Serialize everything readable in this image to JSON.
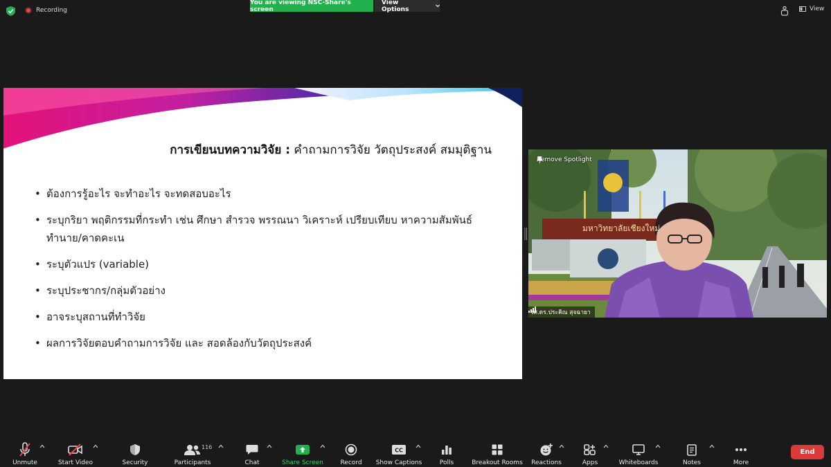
{
  "topbar": {
    "recording_label": "Recording",
    "viewing_banner": "You are viewing NSC-Share's screen",
    "view_options_label": "View Options",
    "view_label": "View"
  },
  "slide": {
    "title_bold": "การเขียนบทความวิจัย :",
    "title_rest": " คำถามการวิจัย วัตถุประสงค์ สมมุติฐาน",
    "bullets": [
      "ต้องการรู้อะไร จะทำอะไร จะทดสอบอะไร",
      "ระบุกริยา พฤติกรรมที่กระทำ เช่น ศึกษา สำรวจ พรรณนา วิเคราะห์ เปรียบเทียบ หาความสัมพันธ์",
      "ทำนาย/คาดคะเน",
      "ระบุตัวแปร (variable)",
      "ระบุประชากร/กลุ่มตัวอย่าง",
      "อาจระบุสถานที่ทำวิจัย",
      "ผลการวิจัยตอบคำถามการวิจัย และ สอดล้องกับวัตถุประสงค์"
    ]
  },
  "video": {
    "remove_spotlight": "Remove Spotlight",
    "participant_name": "รศ.ดร.ประคิณ สุจฉายา",
    "sign_text": "มหาวิทยาลัยเชียงใหม่"
  },
  "toolbar": {
    "unmute": "Unmute",
    "start_video": "Start Video",
    "security": "Security",
    "participants": "Participants",
    "participants_count": "116",
    "chat": "Chat",
    "share_screen": "Share Screen",
    "record": "Record",
    "show_captions": "Show Captions",
    "polls": "Polls",
    "breakout_rooms": "Breakout Rooms",
    "reactions": "Reactions",
    "apps": "Apps",
    "whiteboards": "Whiteboards",
    "notes": "Notes",
    "more": "More",
    "end": "End",
    "cc_text": "CC"
  },
  "colors": {
    "share_green": "#23b14d",
    "end_red": "#d93a3a",
    "background": "#1a1a1a"
  }
}
